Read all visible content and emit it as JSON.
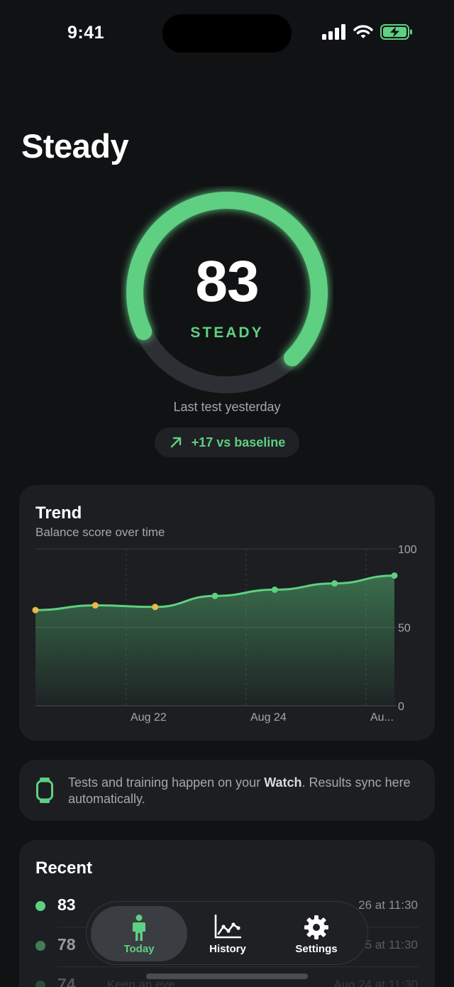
{
  "status_bar": {
    "time": "9:41"
  },
  "page": {
    "title": "Steady"
  },
  "gauge": {
    "score": "83",
    "state": "STEADY",
    "level": 0.83,
    "last_test": "Last test yesterday",
    "baseline_delta": "+17 vs baseline",
    "baseline_icon": "arrow-up-right-icon"
  },
  "trend": {
    "title": "Trend",
    "subtitle": "Balance score over time"
  },
  "chart_data": {
    "type": "area",
    "title": "Trend",
    "subtitle": "Balance score over time",
    "ylim": [
      0,
      100
    ],
    "y_ticks": [
      "100",
      "50",
      "0"
    ],
    "x_tick_labels": [
      "Aug 22",
      "Aug 24",
      "Au..."
    ],
    "grid": true,
    "series": [
      {
        "values": [
          61,
          64,
          63,
          70,
          74,
          78,
          83
        ],
        "point_colors": [
          "#e9b949",
          "#e9b949",
          "#e9b949",
          "#5fcf82",
          "#5fcf82",
          "#5fcf82",
          "#5fcf82"
        ]
      }
    ],
    "line_color": "#5fcf82"
  },
  "watch_note": {
    "text_before": "Tests and training happen on your ",
    "text_bold": "Watch",
    "text_after": ". Results sync here automatically.",
    "icon": "watch-icon"
  },
  "recent": {
    "title": "Recent",
    "rows": [
      {
        "value": "83",
        "label": "",
        "date": "26 at 11:30",
        "color": "#5fcf82"
      },
      {
        "value": "78",
        "label": "",
        "date": "5 at 11:30",
        "color": "#5fcf82"
      },
      {
        "value": "74",
        "label": "Keep an eye",
        "date": "Aug 24 at 11:30",
        "color": "#5fcf82"
      }
    ]
  },
  "tab_bar": {
    "tabs": [
      {
        "label": "Today",
        "icon": "person-icon",
        "active": true
      },
      {
        "label": "History",
        "icon": "chart-icon",
        "active": false
      },
      {
        "label": "Settings",
        "icon": "gear-icon",
        "active": false
      }
    ]
  },
  "colors": {
    "accent": "#5fcf82",
    "warning": "#e9b949",
    "background": "#111214",
    "card": "#1c1e21"
  }
}
